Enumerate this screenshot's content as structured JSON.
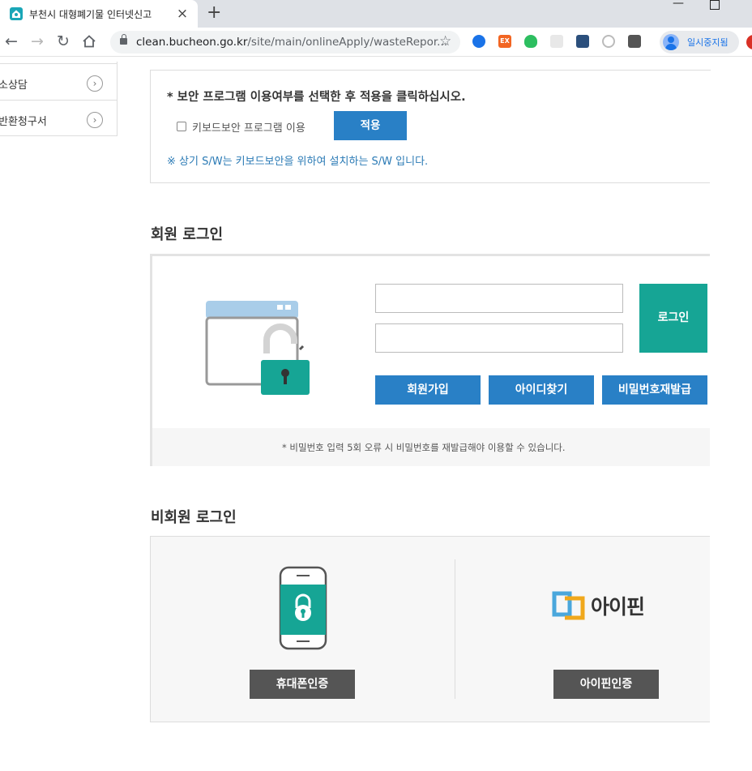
{
  "browser": {
    "tab_title": "부천시 대형폐기물 인터넷신고",
    "url_host": "clean.bucheon.go.kr",
    "url_path": "/site/main/onlineApply/wasteRepor...",
    "profile_label": "일시중지됨",
    "ext_badge": "EX"
  },
  "sidebar": {
    "items": [
      {
        "label": "소상담"
      },
      {
        "label": "반환청구서"
      }
    ]
  },
  "security": {
    "title": "* 보안 프로그램 이용여부를 선택한 후 적용을 클릭하십시오.",
    "checkbox_label": "키보드보안 프로그램 이용",
    "checkbox_checked": false,
    "apply_label": "적용",
    "note": "※ 상기 S/W는 키보드보안을 위하여 설치하는 S/W 입니다."
  },
  "member_login": {
    "heading": "회원 로그인",
    "id_value": "",
    "pw_value": "",
    "login_label": "로그인",
    "join_label": "회원가입",
    "find_id_label": "아이디찾기",
    "reset_pw_label": "비밀번호재발급",
    "notice": "* 비밀번호 입력 5회 오류 시 비밀번호를 재발급해야 이용할 수 있습니다."
  },
  "guest_login": {
    "heading": "비회원 로그인",
    "phone_auth_label": "휴대폰인증",
    "ipin_logo_text": "아이핀",
    "ipin_auth_label": "아이핀인증"
  },
  "colors": {
    "blue_button": "#2980c6",
    "teal_button": "#16a595",
    "dark_button": "#555555"
  }
}
